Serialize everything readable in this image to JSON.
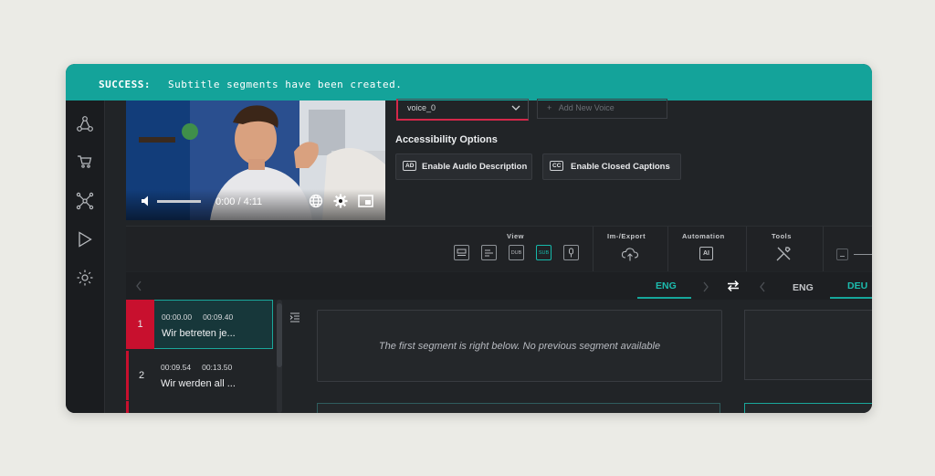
{
  "notification": {
    "label": "SUCCESS:",
    "message": "Subtitle segments have been created."
  },
  "sidebar": {
    "items": [
      "nodes-icon",
      "cart-icon",
      "network-icon",
      "play-icon",
      "gear-icon"
    ]
  },
  "player": {
    "time": "0:00 / 4:11"
  },
  "voice": {
    "selected": "voice_0",
    "add_placeholder": "Add New Voice"
  },
  "accessibility": {
    "title": "Accessibility Options",
    "audio_description": {
      "badge": "AD",
      "label": "Enable Audio Description"
    },
    "closed_captions": {
      "badge": "CC",
      "label": "Enable Closed Captions"
    }
  },
  "toolbar": {
    "view_title": "View",
    "view_icons": [
      "subtitle-view-icon",
      "list-view-icon",
      "DUB",
      "SUB",
      "mic-icon"
    ],
    "import_export_title": "Im-/Export",
    "automation_title": "Automation",
    "automation_icon_text": "AI",
    "tools_title": "Tools"
  },
  "languages": {
    "source": "ENG",
    "target_left": "ENG",
    "target_right": "DEU"
  },
  "segments": [
    {
      "number": "1",
      "start": "00:00.00",
      "end": "00:09.40",
      "text": "Wir betreten je..."
    },
    {
      "number": "2",
      "start": "00:09.54",
      "end": "00:13.50",
      "text": "Wir werden all ..."
    }
  ],
  "previous_segment_note": "The first segment is right below. No previous segment available",
  "colors": {
    "banner": "#14a39a",
    "accent": "#16b8aa",
    "selected_segment": "#c8102e"
  }
}
